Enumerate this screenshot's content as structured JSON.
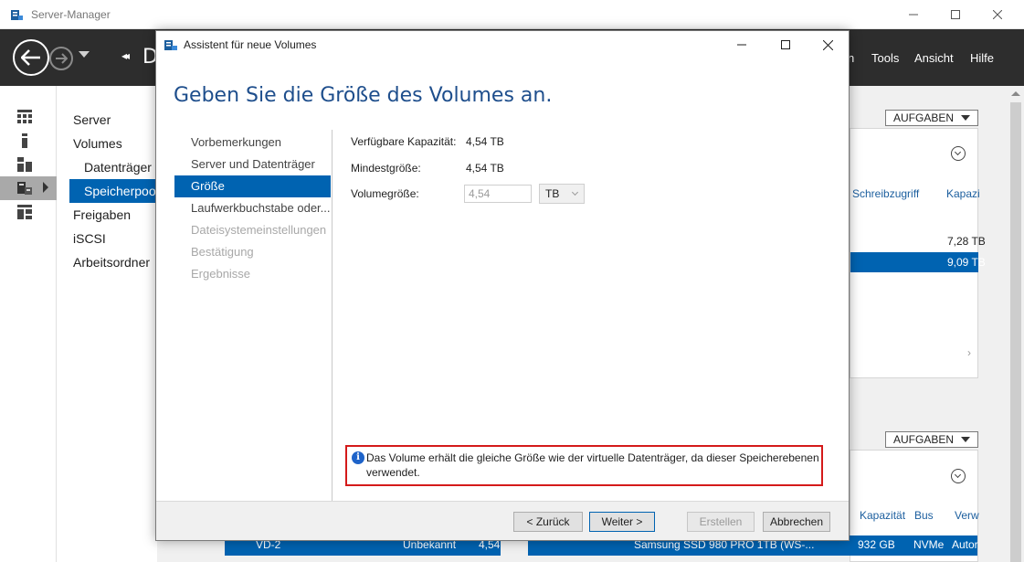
{
  "app": {
    "title": "Server-Manager",
    "breadcrumb_partial": "D",
    "menu": [
      "n",
      "Tools",
      "Ansicht",
      "Hilfe"
    ]
  },
  "sidebar": {
    "items": [
      {
        "label": "Server"
      },
      {
        "label": "Volumes"
      },
      {
        "label": "Datenträger"
      },
      {
        "label": "Speicherpoo"
      },
      {
        "label": "Freigaben"
      },
      {
        "label": "iSCSI"
      },
      {
        "label": "Arbeitsordner"
      }
    ]
  },
  "background": {
    "aufgaben_label": "AUFGABEN",
    "upper_panel": {
      "columns": [
        "Schreibzugriff",
        "Kapazi"
      ],
      "rows": [
        {
          "capacity": "7,28 TB"
        },
        {
          "capacity": "9,09 TB",
          "selected": true
        }
      ]
    },
    "lower_panel": {
      "columns": [
        "Kapazität",
        "Bus",
        "Verw"
      ],
      "left_row": {
        "name": "VD-2",
        "status": "Unbekannt",
        "capacity": "4,54"
      },
      "right_row": {
        "name": "Samsung SSD 980 PRO 1TB (WS-...",
        "capacity": "932 GB",
        "bus": "NVMe",
        "usage": "Autor"
      }
    }
  },
  "wizard": {
    "title": "Assistent für neue Volumes",
    "heading": "Geben Sie die Größe des Volumes an.",
    "steps": [
      {
        "label": "Vorbemerkungen",
        "state": "enabled"
      },
      {
        "label": "Server und Datenträger",
        "state": "enabled"
      },
      {
        "label": "Größe",
        "state": "active"
      },
      {
        "label": "Laufwerkbuchstabe oder...",
        "state": "enabled"
      },
      {
        "label": "Dateisystemeinstellungen",
        "state": "disabled"
      },
      {
        "label": "Bestätigung",
        "state": "disabled"
      },
      {
        "label": "Ergebnisse",
        "state": "disabled"
      }
    ],
    "fields": {
      "available_label": "Verfügbare Kapazität:",
      "available_value": "4,54 TB",
      "min_label": "Mindestgröße:",
      "min_value": "4,54 TB",
      "size_label": "Volumegröße:",
      "size_value": "4,54",
      "unit": "TB"
    },
    "info": "Das Volume erhält die gleiche Größe wie der virtuelle Datenträger, da dieser Speicherebenen verwendet.",
    "buttons": {
      "back": "< Zurück",
      "next": "Weiter >",
      "create": "Erstellen",
      "cancel": "Abbrechen"
    }
  },
  "colors": {
    "accent": "#0063b1",
    "header_bg": "#2d2d2d",
    "heading": "#1e4e8c",
    "highlight_border": "#d41a1a"
  }
}
